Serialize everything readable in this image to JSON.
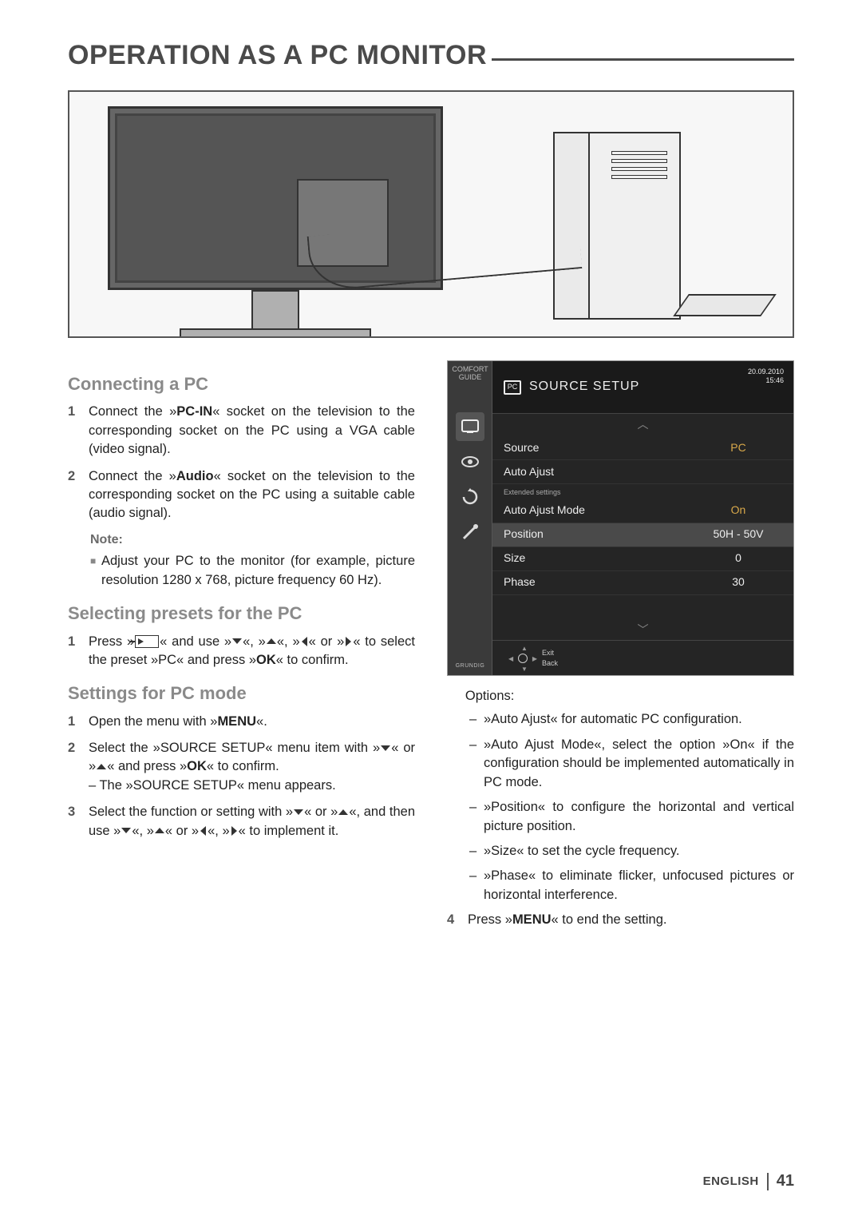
{
  "page_title": "OPERATION AS A PC MONITOR",
  "sections": {
    "connecting": {
      "heading": "Connecting a PC",
      "step1": "Connect the »PC-IN« socket on the television to the corresponding socket on the PC using a VGA cable (video signal).",
      "step1_bold": "PC-IN",
      "step2": "Connect the »Audio« socket on the television to the corresponding socket on the PC using a suitable cable (audio signal).",
      "step2_bold": "Audio",
      "note_label": "Note:",
      "note_body": "Adjust your PC to the monitor (for example, picture resolution 1280 x 768, picture frequency 60 Hz)."
    },
    "presets": {
      "heading": "Selecting presets for the PC",
      "step1_a": "Press »",
      "step1_b": "« and use »",
      "step1_c": "«, »",
      "step1_d": "«, »",
      "step1_e": "« or »",
      "step1_f": "« to select the preset »PC« and press »",
      "step1_g": "« to confirm.",
      "ok": "OK"
    },
    "settings": {
      "heading": "Settings for PC mode",
      "step1": "Open the menu with »MENU«.",
      "menu": "MENU",
      "step2_a": " Select the »SOURCE SETUP« menu item with »",
      "step2_b": "« or »",
      "step2_c": "« and press »",
      "step2_d": "« to confirm.",
      "step2_sub": "– The »SOURCE SETUP« menu appears.",
      "step3_a": "Select the function or setting with »",
      "step3_b": "« or »",
      "step3_c": "«, and then use »",
      "step3_d": "«, »",
      "step3_e": "« or »",
      "step3_f": "«, »",
      "step3_g": "« to implement it."
    },
    "options": {
      "label": "Options:",
      "o1": "»Auto Ajust« for automatic PC configuration.",
      "o2": "»Auto Ajust Mode«, select the option »On« if the configuration should be implemented automatically in PC mode.",
      "o3": "»Position« to configure the horizontal and vertical picture position.",
      "o4": "»Size« to set the cycle frequency.",
      "o5": "»Phase« to eliminate flicker, unfocused pictures or horizontal interference.",
      "step4_a": "Press »",
      "step4_b": "« to end the setting."
    }
  },
  "osd": {
    "comfort": "COMFORT GUIDE",
    "brand": "GRUNDIG",
    "title": "SOURCE SETUP",
    "date": "20.09.2010",
    "time": "15:46",
    "pc_label": "PC",
    "rows": {
      "source_k": "Source",
      "source_v": "PC",
      "autoajust_k": "Auto Ajust",
      "ext": "Extended settings",
      "mode_k": "Auto Ajust Mode",
      "mode_v": "On",
      "position_k": "Position",
      "position_v": "50H - 50V",
      "size_k": "Size",
      "size_v": "0",
      "phase_k": "Phase",
      "phase_v": "30"
    },
    "footer": {
      "exit": "Exit",
      "back": "Back"
    }
  },
  "footer": {
    "language": "ENGLISH",
    "page_number": "41"
  }
}
